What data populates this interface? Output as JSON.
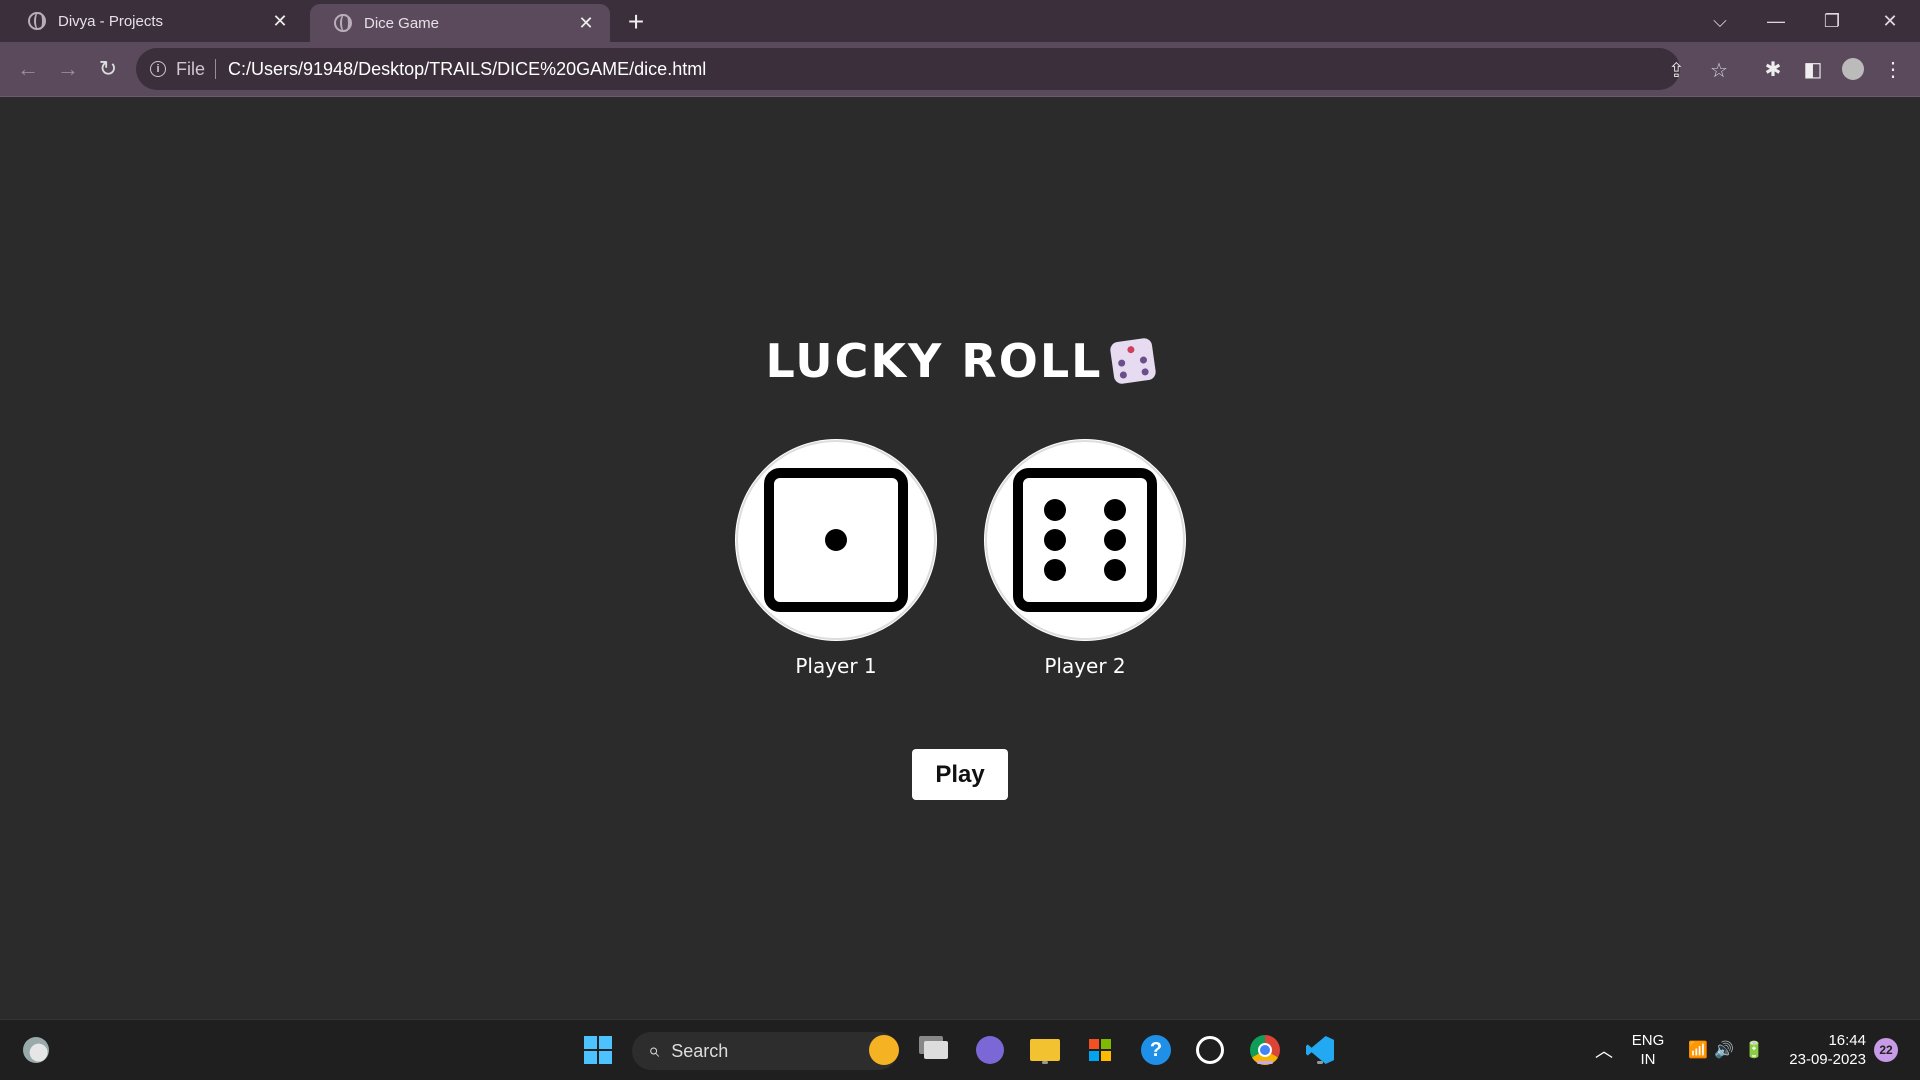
{
  "browser": {
    "tabs": [
      {
        "title": "Divya - Projects",
        "active": false
      },
      {
        "title": "Dice Game",
        "active": true
      }
    ],
    "address": {
      "scheme_label": "File",
      "url": "C:/Users/91948/Desktop/TRAILS/DICE%20GAME/dice.html"
    }
  },
  "page": {
    "heading": "LUCKY ROLL",
    "heading_emoji": "game-die",
    "players": [
      {
        "label": "Player 1",
        "die_value": 1
      },
      {
        "label": "Player 2",
        "die_value": 6
      }
    ],
    "play_label": "Play"
  },
  "taskbar": {
    "search_label": "Search",
    "language": "ENG",
    "region": "IN",
    "time": "16:44",
    "date": "23-09-2023",
    "notification_count": "22"
  },
  "colors": {
    "page_background": "#2b2b2b",
    "tab_strip": "#3b2f3b",
    "toolbar": "#5a4a5b",
    "taskbar": "#1f1f1f"
  }
}
